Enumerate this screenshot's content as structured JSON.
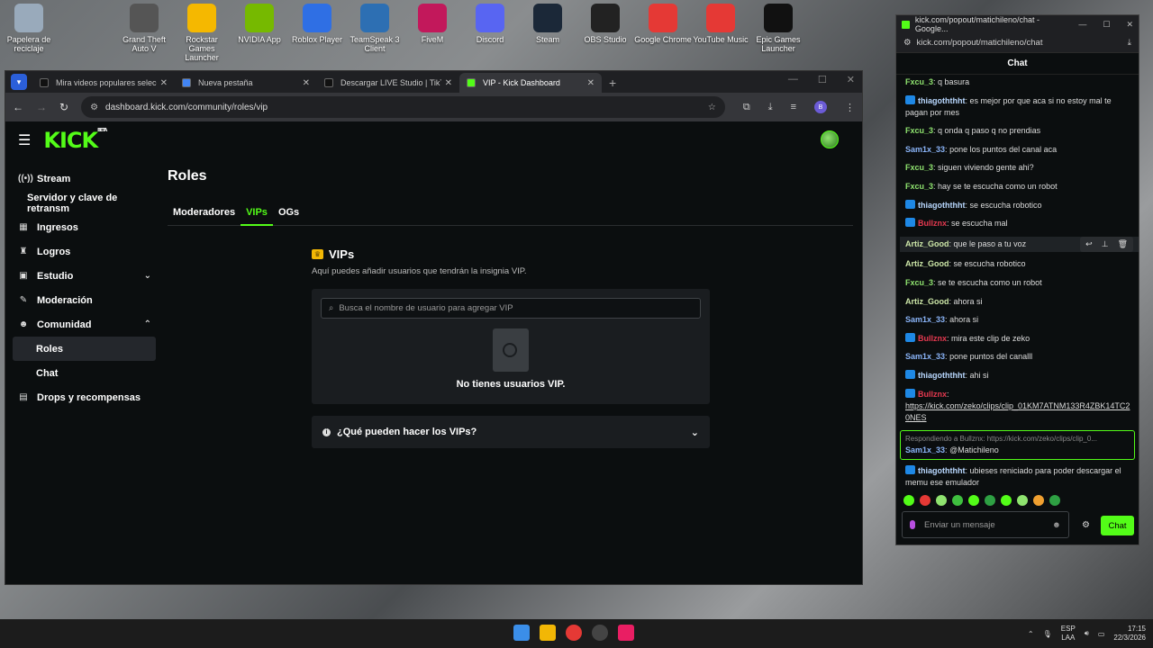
{
  "desktop": {
    "icons": [
      {
        "label": "Papelera de reciclaje",
        "icon": "recycle-bin-icon",
        "color": "#9ab"
      },
      {
        "label": "Grand Theft Auto V",
        "icon": "gta-icon",
        "color": "#555"
      },
      {
        "label": "Rockstar Games Launcher",
        "icon": "rockstar-icon",
        "color": "#f5b800"
      },
      {
        "label": "NVIDIA App",
        "icon": "nvidia-icon",
        "color": "#76b900"
      },
      {
        "label": "Roblox Player",
        "icon": "roblox-icon",
        "color": "#2f6fe4"
      },
      {
        "label": "TeamSpeak 3 Client",
        "icon": "teamspeak-icon",
        "color": "#2d6fb3"
      },
      {
        "label": "FiveM",
        "icon": "fivem-icon",
        "color": "#c2185b"
      },
      {
        "label": "Discord",
        "icon": "discord-icon",
        "color": "#5865f2"
      },
      {
        "label": "Steam",
        "icon": "steam-icon",
        "color": "#1b2838"
      },
      {
        "label": "OBS Studio",
        "icon": "obs-icon",
        "color": "#222"
      },
      {
        "label": "Google Chrome",
        "icon": "chrome-icon",
        "color": "#e53935"
      },
      {
        "label": "YouTube Music",
        "icon": "youtube-music-icon",
        "color": "#e53935"
      },
      {
        "label": "Epic Games Launcher",
        "icon": "epic-games-icon",
        "color": "#111"
      }
    ]
  },
  "browser": {
    "tabs": [
      {
        "title": "Mira videos populares seleccio",
        "icon": "tiktok-icon"
      },
      {
        "title": "Nueva pestaña",
        "icon": "chrome-icon"
      },
      {
        "title": "Descargar LIVE Studio | TikTok",
        "icon": "tiktok-icon"
      },
      {
        "title": "VIP - Kick Dashboard",
        "icon": "kick-icon",
        "active": true
      }
    ],
    "url": "dashboard.kick.com/community/roles/vip",
    "profile_initial": "B"
  },
  "kick": {
    "logo": "KICK",
    "logo_badge": "BETA",
    "sidebar": [
      {
        "label": "Stream",
        "icon": "broadcast-icon"
      },
      {
        "label": "Servidor y clave de retransm",
        "icon": ""
      },
      {
        "label": "Ingresos",
        "icon": "chart-icon"
      },
      {
        "label": "Logros",
        "icon": "trophy-icon"
      },
      {
        "label": "Estudio",
        "icon": "studio-icon",
        "chevron": "down"
      },
      {
        "label": "Moderación",
        "icon": "wrench-icon"
      },
      {
        "label": "Comunidad",
        "icon": "users-icon",
        "chevron": "up"
      },
      {
        "label": "Roles",
        "sub": true,
        "active": true
      },
      {
        "label": "Chat",
        "sub": true
      },
      {
        "label": "Drops y recompensas",
        "icon": "gift-icon"
      }
    ],
    "page_title": "Roles",
    "tabs": [
      "Moderadores",
      "VIPs",
      "OGs"
    ],
    "active_tab": "VIPs",
    "vip": {
      "title": "VIPs",
      "description": "Aquí puedes añadir usuarios que tendrán la insignia VIP.",
      "search_placeholder": "Busca el nombre de usuario para agregar VIP",
      "empty_text": "No tienes usuarios VIP.",
      "faq": "¿Qué pueden hacer los VIPs?"
    }
  },
  "chat_window": {
    "title": "kick.com/popout/matichileno/chat - Google...",
    "url": "kick.com/popout/matichileno/chat",
    "header": "Chat",
    "messages": [
      {
        "user": "Fxcu_3",
        "color": "#8fe36f",
        "text": "q basura"
      },
      {
        "user": "thiagoththht",
        "color": "#b9d8ff",
        "badge": true,
        "text": "es mejor por que aca si no estoy mal te pagan por mes"
      },
      {
        "user": "Fxcu_3",
        "color": "#8fe36f",
        "text": "q onda q paso q no prendias"
      },
      {
        "user": "Sam1x_33",
        "color": "#8ab4f8",
        "text": "pone los puntos del canal aca"
      },
      {
        "user": "Fxcu_3",
        "color": "#8fe36f",
        "text": "siguen viviendo gente ahi?"
      },
      {
        "user": "Fxcu_3",
        "color": "#8fe36f",
        "text": "hay se te escucha como un robot"
      },
      {
        "user": "thiagoththht",
        "color": "#b9d8ff",
        "badge": true,
        "text": "se escucha robotico"
      },
      {
        "user": "Bullznx",
        "color": "#e53950",
        "badge": true,
        "text": "se escucha mal"
      },
      {
        "user": "Artiz_Good",
        "color": "#cde7a8",
        "text": "que le paso a tu voz",
        "hover": true
      },
      {
        "user": "Artiz_Good",
        "color": "#cde7a8",
        "text": "se escucha robotico"
      },
      {
        "user": "Fxcu_3",
        "color": "#8fe36f",
        "text": "se te escucha como un robot"
      },
      {
        "user": "Artiz_Good",
        "color": "#cde7a8",
        "text": "ahora si"
      },
      {
        "user": "Sam1x_33",
        "color": "#8ab4f8",
        "text": "ahora si"
      },
      {
        "user": "Bullznx",
        "color": "#e53950",
        "badge": true,
        "text": "mira este clip de zeko"
      },
      {
        "user": "Sam1x_33",
        "color": "#8ab4f8",
        "text": "pone puntos del canalll"
      },
      {
        "user": "thiagoththht",
        "color": "#b9d8ff",
        "badge": true,
        "text": "ahi si"
      },
      {
        "user": "Bullznx",
        "color": "#e53950",
        "badge": true,
        "text": "",
        "link": "https://kick.com/zeko/clips/clip_01KM7ATNM133R4ZBK14TC20NES"
      },
      {
        "user": "Sam1x_33",
        "color": "#8ab4f8",
        "text": "@Matichileno",
        "reply": "Respondiendo a Bullznx: https://kick.com/zeko/clips/clip_0..."
      },
      {
        "user": "thiagoththht",
        "color": "#b9d8ff",
        "badge": true,
        "text": "ubieses reniciado para poder descargar el memu ese emulador"
      }
    ],
    "input_placeholder": "Enviar un mensaje",
    "send_label": "Chat"
  },
  "taskbar": {
    "lang_top": "ESP",
    "lang_bottom": "LAA",
    "time": "17:15",
    "date": "22/3/2026"
  },
  "colors": {
    "accent": "#53fc18"
  }
}
